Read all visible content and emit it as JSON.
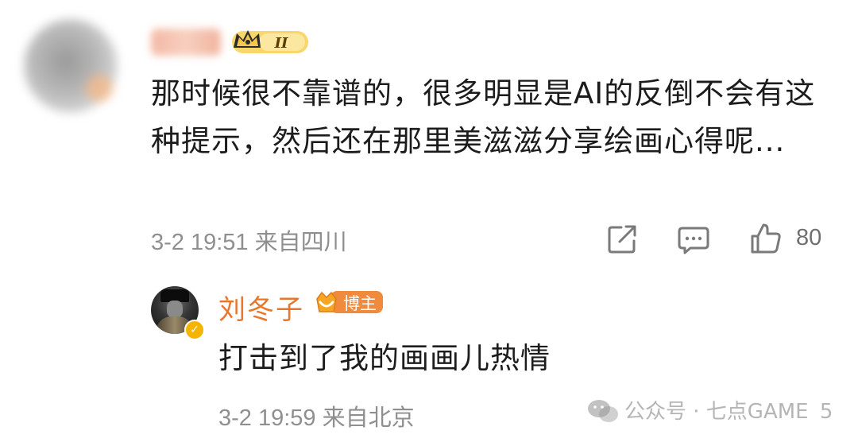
{
  "comment": {
    "text": "那时候很不靠谱的，很多明显是AI的反倒不会有这种提示，然后还在那里美滋滋分享绘画心得呢...",
    "level_badge": "II",
    "meta": "3-2 19:51 来自四川",
    "like_count": "80",
    "icons": [
      "share-icon",
      "comment-icon",
      "like-icon"
    ]
  },
  "reply": {
    "username": "刘冬子",
    "badge": "博主",
    "text": "打击到了我的画画儿热情",
    "meta": "3-2 19:59 来自北京"
  },
  "watermark": {
    "text": "公众号 · 七点GAME",
    "trailing": "5"
  },
  "colors": {
    "accent_orange": "#e8762d",
    "badge_gold": "#f5b400",
    "meta_gray": "#8f8f8f"
  }
}
